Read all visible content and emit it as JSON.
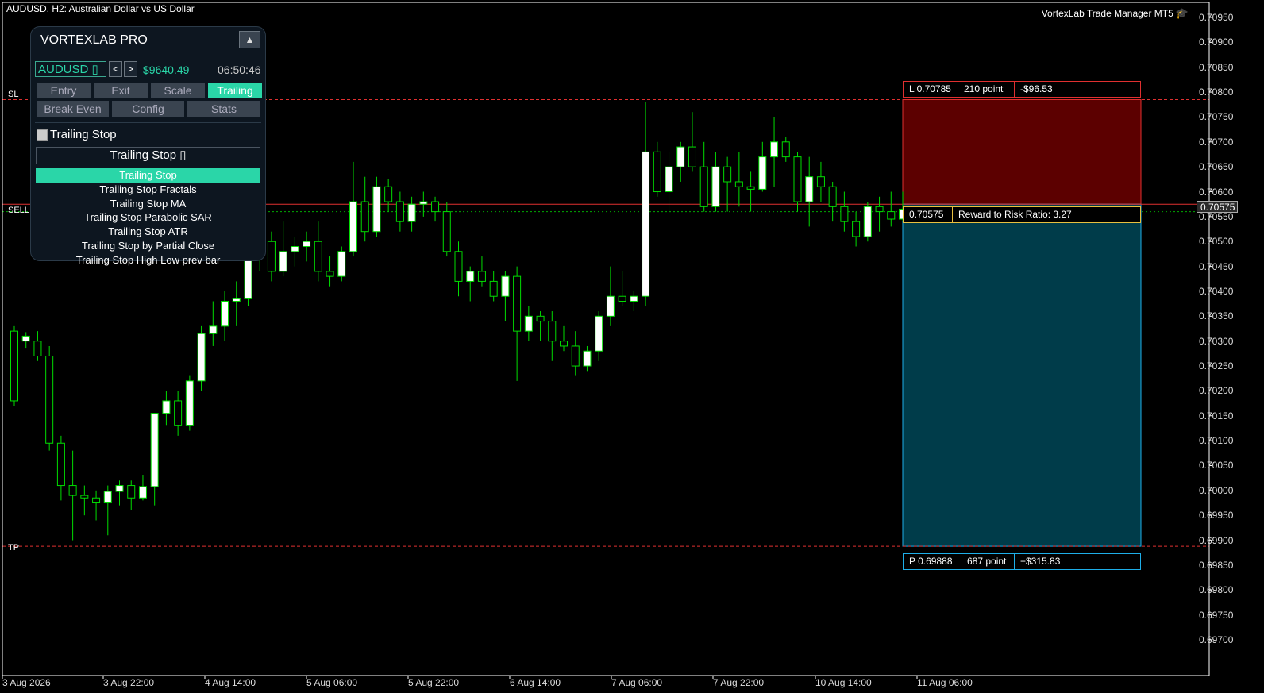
{
  "window": {
    "symbol_title": "AUDUSD, H2:  Australian Dollar vs US Dollar",
    "tool_title": "VortexLab Trade Manager MT5",
    "tool_icon": "graduation-cap-icon"
  },
  "colors": {
    "background": "#000000",
    "candle_up": "#ffffff",
    "candle_wick": "#00dd00",
    "sl_line": "#e03030",
    "tp_line": "#1eaee8",
    "risk_zone": "#5c0000",
    "reward_zone": "#003c4a",
    "accent": "#2ad6a8"
  },
  "price_axis": {
    "ticks": [
      "0.70950",
      "0.70900",
      "0.70850",
      "0.70800",
      "0.70750",
      "0.70700",
      "0.70650",
      "0.70600",
      "0.70550",
      "0.70500",
      "0.70450",
      "0.70400",
      "0.70350",
      "0.70300",
      "0.70250",
      "0.70200",
      "0.70150",
      "0.70100",
      "0.70050",
      "0.70000",
      "0.69950",
      "0.69900",
      "0.69850",
      "0.69800",
      "0.69750",
      "0.69700"
    ],
    "current_price": "0.70575"
  },
  "time_axis": {
    "ticks": [
      "3 Aug 2026",
      "3 Aug 22:00",
      "4 Aug 14:00",
      "5 Aug 06:00",
      "5 Aug 22:00",
      "6 Aug 14:00",
      "7 Aug 06:00",
      "7 Aug 22:00",
      "10 Aug 14:00",
      "11 Aug 06:00"
    ]
  },
  "lines": {
    "sl_label": "SL",
    "sell_label": "SELL",
    "tp_label": "TP"
  },
  "trade": {
    "sl_price": "L 0.70785",
    "sl_points": "210 point",
    "sl_money": "-$96.53",
    "entry_price": "0.70575",
    "rr_text": "Reward to Risk Ratio:  3.27",
    "tp_price": "P 0.69888",
    "tp_points": "687 point",
    "tp_money": "+$315.83"
  },
  "panel": {
    "title": "VORTEXLAB PRO",
    "collapse_glyph": "▲",
    "symbol": "AUDUSD  ▯",
    "prev": "<",
    "next": ">",
    "balance": "$9640.49",
    "clock": "06:50:46",
    "tabs_row1": [
      "Entry",
      "Exit",
      "Scale",
      "Trailing"
    ],
    "tabs_row2": [
      "Break Even",
      "Config",
      "Stats"
    ],
    "active_tab": "Trailing",
    "trailing_checkbox_label": "Trailing Stop",
    "trailing_dropdown": "Trailing Stop  ▯",
    "trailing_options": [
      "Trailing Stop",
      "Trailing Stop Fractals",
      "Trailing Stop MA",
      "Trailing Stop Parabolic SAR",
      "Trailing Stop ATR",
      "Trailing Stop by Partial Close",
      "Trailing Stop High Low prev bar"
    ],
    "selected_option": "Trailing Stop"
  },
  "chart_data": {
    "type": "candlestick",
    "title": "AUDUSD, H2:  Australian Dollar vs US Dollar",
    "xlabel": "",
    "ylabel": "",
    "ylim": [
      0.6967,
      0.70985
    ],
    "grid": false,
    "candles": [
      [
        0.7032,
        0.7033,
        0.7017,
        0.7018
      ],
      [
        0.703,
        0.70318,
        0.70285,
        0.7031
      ],
      [
        0.703,
        0.7032,
        0.7026,
        0.7027
      ],
      [
        0.7027,
        0.7029,
        0.7008,
        0.70095
      ],
      [
        0.70095,
        0.7011,
        0.6998,
        0.7001
      ],
      [
        0.7001,
        0.7008,
        0.699,
        0.6999
      ],
      [
        0.6999,
        0.7001,
        0.6995,
        0.69985
      ],
      [
        0.69985,
        0.7,
        0.6994,
        0.69975
      ],
      [
        0.69975,
        0.7001,
        0.6991,
        0.69998
      ],
      [
        0.69998,
        0.7002,
        0.6997,
        0.7001
      ],
      [
        0.7001,
        0.7002,
        0.6996,
        0.69985
      ],
      [
        0.69985,
        0.7003,
        0.6998,
        0.70008
      ],
      [
        0.70008,
        0.7006,
        0.6997,
        0.70155
      ],
      [
        0.70155,
        0.702,
        0.7013,
        0.7018
      ],
      [
        0.7018,
        0.702,
        0.7011,
        0.7013
      ],
      [
        0.7013,
        0.7023,
        0.7012,
        0.7022
      ],
      [
        0.7022,
        0.7033,
        0.702,
        0.70315
      ],
      [
        0.70315,
        0.7038,
        0.7029,
        0.7033
      ],
      [
        0.7033,
        0.704,
        0.703,
        0.7038
      ],
      [
        0.7038,
        0.7042,
        0.7033,
        0.70385
      ],
      [
        0.70385,
        0.7051,
        0.7037,
        0.7049
      ],
      [
        0.7049,
        0.7052,
        0.7044,
        0.705
      ],
      [
        0.705,
        0.7052,
        0.7042,
        0.7044
      ],
      [
        0.7044,
        0.7054,
        0.7043,
        0.7048
      ],
      [
        0.7048,
        0.7051,
        0.7045,
        0.7049
      ],
      [
        0.7049,
        0.7052,
        0.7046,
        0.705
      ],
      [
        0.705,
        0.7054,
        0.7042,
        0.7044
      ],
      [
        0.7044,
        0.7047,
        0.7041,
        0.7043
      ],
      [
        0.7043,
        0.7049,
        0.7042,
        0.7048
      ],
      [
        0.7048,
        0.7066,
        0.7047,
        0.7058
      ],
      [
        0.7058,
        0.7063,
        0.705,
        0.7052
      ],
      [
        0.7052,
        0.7063,
        0.7051,
        0.7061
      ],
      [
        0.7061,
        0.70625,
        0.7056,
        0.7058
      ],
      [
        0.7058,
        0.706,
        0.7052,
        0.7054
      ],
      [
        0.7054,
        0.7059,
        0.7052,
        0.70575
      ],
      [
        0.70575,
        0.706,
        0.7055,
        0.7058
      ],
      [
        0.7058,
        0.7059,
        0.7054,
        0.7056
      ],
      [
        0.7056,
        0.7058,
        0.7047,
        0.7048
      ],
      [
        0.7048,
        0.705,
        0.7039,
        0.7042
      ],
      [
        0.7042,
        0.7045,
        0.7038,
        0.7044
      ],
      [
        0.7044,
        0.7047,
        0.7041,
        0.7042
      ],
      [
        0.7042,
        0.7044,
        0.7038,
        0.7039
      ],
      [
        0.7039,
        0.7044,
        0.7034,
        0.7043
      ],
      [
        0.7043,
        0.7045,
        0.7022,
        0.7032
      ],
      [
        0.7032,
        0.7037,
        0.703,
        0.7035
      ],
      [
        0.7035,
        0.7036,
        0.703,
        0.7034
      ],
      [
        0.7034,
        0.7036,
        0.7026,
        0.703
      ],
      [
        0.703,
        0.7033,
        0.7028,
        0.7029
      ],
      [
        0.7029,
        0.7032,
        0.7023,
        0.7025
      ],
      [
        0.7025,
        0.7029,
        0.7024,
        0.7028
      ],
      [
        0.7028,
        0.7036,
        0.7026,
        0.7035
      ],
      [
        0.7035,
        0.7045,
        0.7033,
        0.7039
      ],
      [
        0.7039,
        0.7044,
        0.7037,
        0.7038
      ],
      [
        0.7038,
        0.704,
        0.7036,
        0.7039
      ],
      [
        0.7039,
        0.7078,
        0.7037,
        0.7068
      ],
      [
        0.7068,
        0.707,
        0.7059,
        0.706
      ],
      [
        0.706,
        0.7068,
        0.7056,
        0.7065
      ],
      [
        0.7065,
        0.707,
        0.7062,
        0.7069
      ],
      [
        0.7069,
        0.7076,
        0.7064,
        0.7065
      ],
      [
        0.7065,
        0.707,
        0.7056,
        0.7057
      ],
      [
        0.7057,
        0.7068,
        0.7056,
        0.7065
      ],
      [
        0.7065,
        0.7067,
        0.7056,
        0.7062
      ],
      [
        0.7062,
        0.7068,
        0.7057,
        0.7061
      ],
      [
        0.7061,
        0.7064,
        0.7056,
        0.70605
      ],
      [
        0.70605,
        0.707,
        0.706,
        0.7067
      ],
      [
        0.7067,
        0.7075,
        0.7061,
        0.707
      ],
      [
        0.707,
        0.7071,
        0.7066,
        0.7067
      ],
      [
        0.7067,
        0.7068,
        0.7056,
        0.7058
      ],
      [
        0.7058,
        0.7067,
        0.7053,
        0.7063
      ],
      [
        0.7063,
        0.7066,
        0.7058,
        0.7061
      ],
      [
        0.7061,
        0.7062,
        0.7054,
        0.7057
      ],
      [
        0.7057,
        0.706,
        0.7052,
        0.7054
      ],
      [
        0.7054,
        0.7056,
        0.7049,
        0.7051
      ],
      [
        0.7051,
        0.7058,
        0.705,
        0.7057
      ],
      [
        0.7057,
        0.7059,
        0.7052,
        0.7056
      ],
      [
        0.7056,
        0.706,
        0.7053,
        0.70545
      ],
      [
        0.70545,
        0.706,
        0.7054,
        0.70565
      ]
    ]
  }
}
